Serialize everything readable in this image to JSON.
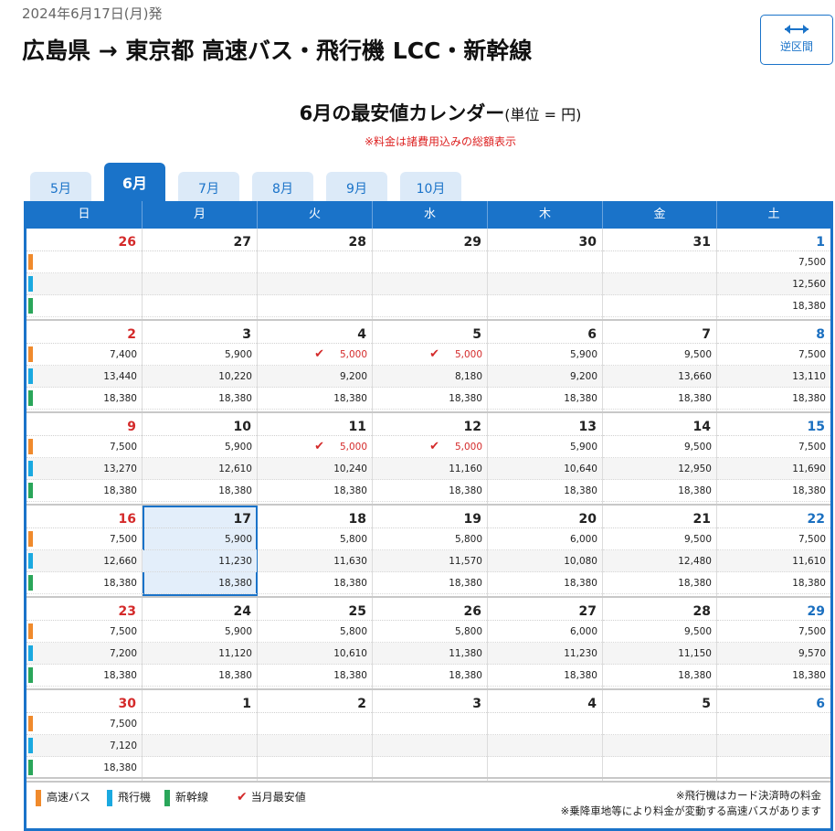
{
  "header": {
    "date": "2024年6月17日(月)発",
    "title": "広島県 → 東京都 高速バス・飛行機 LCC・新幹線",
    "reverse_label": "逆区間"
  },
  "calendar": {
    "title": "6月の最安値カレンダー",
    "unit": "(単位 = 円)",
    "note": "※料金は諸費用込みの総額表示",
    "tabs": [
      {
        "label": "5月",
        "active": false
      },
      {
        "label": "6月",
        "active": true
      },
      {
        "label": "7月",
        "active": false
      },
      {
        "label": "8月",
        "active": false
      },
      {
        "label": "9月",
        "active": false
      },
      {
        "label": "10月",
        "active": false
      }
    ],
    "weekdays": [
      "日",
      "月",
      "火",
      "水",
      "木",
      "金",
      "土"
    ],
    "weeks": [
      [
        {
          "day": "26",
          "prices": [
            "",
            "",
            ""
          ],
          "bars": true
        },
        {
          "day": "27",
          "prices": [
            "",
            "",
            ""
          ]
        },
        {
          "day": "28",
          "prices": [
            "",
            "",
            ""
          ]
        },
        {
          "day": "29",
          "prices": [
            "",
            "",
            ""
          ]
        },
        {
          "day": "30",
          "prices": [
            "",
            "",
            ""
          ]
        },
        {
          "day": "31",
          "prices": [
            "",
            "",
            ""
          ]
        },
        {
          "day": "1",
          "prices": [
            "7,500",
            "12,560",
            "18,380"
          ]
        }
      ],
      [
        {
          "day": "2",
          "prices": [
            "7,400",
            "13,440",
            "18,380"
          ],
          "bars": true
        },
        {
          "day": "3",
          "prices": [
            "5,900",
            "10,220",
            "18,380"
          ]
        },
        {
          "day": "4",
          "prices": [
            "5,000",
            "9,200",
            "18,380"
          ],
          "cheap": true
        },
        {
          "day": "5",
          "prices": [
            "5,000",
            "8,180",
            "18,380"
          ],
          "cheap": true
        },
        {
          "day": "6",
          "prices": [
            "5,900",
            "9,200",
            "18,380"
          ]
        },
        {
          "day": "7",
          "prices": [
            "9,500",
            "13,660",
            "18,380"
          ]
        },
        {
          "day": "8",
          "prices": [
            "7,500",
            "13,110",
            "18,380"
          ]
        }
      ],
      [
        {
          "day": "9",
          "prices": [
            "7,500",
            "13,270",
            "18,380"
          ],
          "bars": true
        },
        {
          "day": "10",
          "prices": [
            "5,900",
            "12,610",
            "18,380"
          ]
        },
        {
          "day": "11",
          "prices": [
            "5,000",
            "10,240",
            "18,380"
          ],
          "cheap": true
        },
        {
          "day": "12",
          "prices": [
            "5,000",
            "11,160",
            "18,380"
          ],
          "cheap": true
        },
        {
          "day": "13",
          "prices": [
            "5,900",
            "10,640",
            "18,380"
          ]
        },
        {
          "day": "14",
          "prices": [
            "9,500",
            "12,950",
            "18,380"
          ]
        },
        {
          "day": "15",
          "prices": [
            "7,500",
            "11,690",
            "18,380"
          ]
        }
      ],
      [
        {
          "day": "16",
          "prices": [
            "7,500",
            "12,660",
            "18,380"
          ],
          "bars": true
        },
        {
          "day": "17",
          "prices": [
            "5,900",
            "11,230",
            "18,380"
          ],
          "selected": true
        },
        {
          "day": "18",
          "prices": [
            "5,800",
            "11,630",
            "18,380"
          ]
        },
        {
          "day": "19",
          "prices": [
            "5,800",
            "11,570",
            "18,380"
          ]
        },
        {
          "day": "20",
          "prices": [
            "6,000",
            "10,080",
            "18,380"
          ]
        },
        {
          "day": "21",
          "prices": [
            "9,500",
            "12,480",
            "18,380"
          ]
        },
        {
          "day": "22",
          "prices": [
            "7,500",
            "11,610",
            "18,380"
          ]
        }
      ],
      [
        {
          "day": "23",
          "prices": [
            "7,500",
            "7,200",
            "18,380"
          ],
          "bars": true
        },
        {
          "day": "24",
          "prices": [
            "5,900",
            "11,120",
            "18,380"
          ]
        },
        {
          "day": "25",
          "prices": [
            "5,800",
            "10,610",
            "18,380"
          ]
        },
        {
          "day": "26",
          "prices": [
            "5,800",
            "11,380",
            "18,380"
          ]
        },
        {
          "day": "27",
          "prices": [
            "6,000",
            "11,230",
            "18,380"
          ]
        },
        {
          "day": "28",
          "prices": [
            "9,500",
            "11,150",
            "18,380"
          ]
        },
        {
          "day": "29",
          "prices": [
            "7,500",
            "9,570",
            "18,380"
          ]
        }
      ],
      [
        {
          "day": "30",
          "prices": [
            "7,500",
            "7,120",
            "18,380"
          ],
          "bars": true
        },
        {
          "day": "1",
          "prices": [
            "",
            "",
            ""
          ]
        },
        {
          "day": "2",
          "prices": [
            "",
            "",
            ""
          ]
        },
        {
          "day": "3",
          "prices": [
            "",
            "",
            ""
          ]
        },
        {
          "day": "4",
          "prices": [
            "",
            "",
            ""
          ]
        },
        {
          "day": "5",
          "prices": [
            "",
            "",
            ""
          ]
        },
        {
          "day": "6",
          "prices": [
            "",
            "",
            ""
          ]
        }
      ]
    ],
    "legend": {
      "bus": "高速バス",
      "air": "飛行機",
      "rail": "新幹線",
      "cheapest": "当月最安値",
      "note1": "※飛行機はカード決済時の料金",
      "note2": "※乗降車地等により料金が変動する高速バスがあります"
    },
    "colors": {
      "bus": "#f08a2c",
      "air": "#1aa9e0",
      "rail": "#2aa65a",
      "accent": "#1a73c9",
      "cheap": "#d42a2a"
    }
  }
}
